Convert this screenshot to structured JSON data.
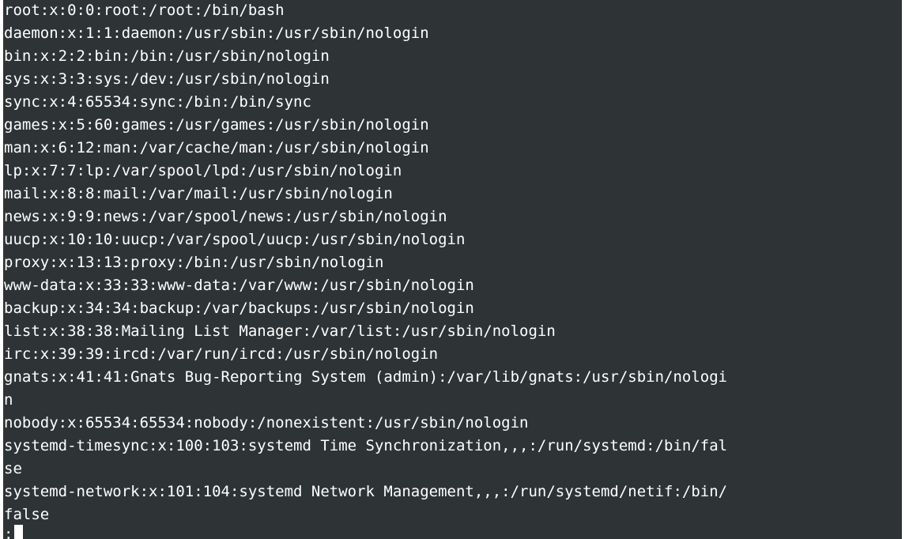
{
  "terminal": {
    "lines": [
      "root:x:0:0:root:/root:/bin/bash",
      "daemon:x:1:1:daemon:/usr/sbin:/usr/sbin/nologin",
      "bin:x:2:2:bin:/bin:/usr/sbin/nologin",
      "sys:x:3:3:sys:/dev:/usr/sbin/nologin",
      "sync:x:4:65534:sync:/bin:/bin/sync",
      "games:x:5:60:games:/usr/games:/usr/sbin/nologin",
      "man:x:6:12:man:/var/cache/man:/usr/sbin/nologin",
      "lp:x:7:7:lp:/var/spool/lpd:/usr/sbin/nologin",
      "mail:x:8:8:mail:/var/mail:/usr/sbin/nologin",
      "news:x:9:9:news:/var/spool/news:/usr/sbin/nologin",
      "uucp:x:10:10:uucp:/var/spool/uucp:/usr/sbin/nologin",
      "proxy:x:13:13:proxy:/bin:/usr/sbin/nologin",
      "www-data:x:33:33:www-data:/var/www:/usr/sbin/nologin",
      "backup:x:34:34:backup:/var/backups:/usr/sbin/nologin",
      "list:x:38:38:Mailing List Manager:/var/list:/usr/sbin/nologin",
      "irc:x:39:39:ircd:/var/run/ircd:/usr/sbin/nologin",
      "gnats:x:41:41:Gnats Bug-Reporting System (admin):/var/lib/gnats:/usr/sbin/nologi",
      "n",
      "nobody:x:65534:65534:nobody:/nonexistent:/usr/sbin/nologin",
      "systemd-timesync:x:100:103:systemd Time Synchronization,,,:/run/systemd:/bin/fal",
      "se",
      "systemd-network:x:101:104:systemd Network Management,,,:/run/systemd/netif:/bin/",
      "false"
    ],
    "prompt": ":"
  }
}
